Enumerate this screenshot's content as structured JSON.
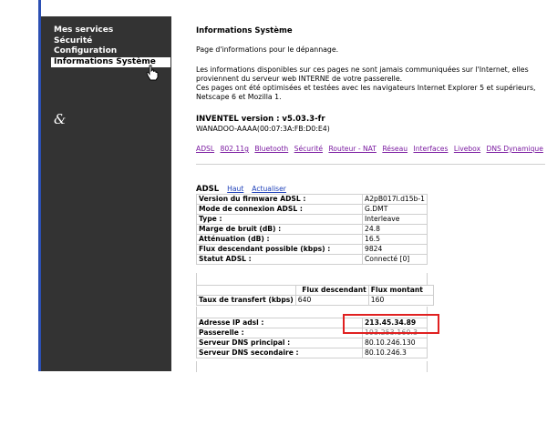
{
  "sidebar": {
    "items": [
      {
        "label": "Mes services"
      },
      {
        "label": "Sécurité"
      },
      {
        "label": "Configuration"
      },
      {
        "label": "Informations Système"
      }
    ],
    "logo": "&"
  },
  "main": {
    "title": "Informations Système",
    "intro": "Page d'informations pour le dépannage.",
    "desc1": "Les informations disponibles sur ces pages ne sont jamais communiquées sur l'Internet, elles",
    "desc2": "proviennent du serveur web INTERNE de votre passerelle.",
    "desc3": "Ces pages ont été optimisées et testées avec les navigateurs Internet Explorer 5 et supérieurs,",
    "desc4": "Netscape 6 et Mozilla 1.",
    "version": "INVENTEL version : v5.03.3-fr",
    "device": "WANADOO-AAAA(00:07:3A:FB:D0:E4)",
    "links": [
      "ADSL",
      "802.11g",
      "Bluetooth",
      "Sécurité",
      "Routeur - NAT",
      "Réseau",
      "Interfaces",
      "Livebox",
      "DNS Dynamique"
    ]
  },
  "adsl": {
    "heading": "ADSL",
    "haut": "Haut",
    "actualiser": "Actualiser",
    "rows": [
      {
        "label": "Version du firmware ADSL :",
        "value": "A2pB017l.d15b-1"
      },
      {
        "label": "Mode de connexion ADSL :",
        "value": "G.DMT"
      },
      {
        "label": "Type :",
        "value": "Interleave"
      },
      {
        "label": "Marge de bruit (dB) :",
        "value": "24.8"
      },
      {
        "label": "Atténuation (dB) :",
        "value": "16.5"
      },
      {
        "label": "Flux descendant possible (kbps) :",
        "value": "9824"
      },
      {
        "label": "Statut ADSL :",
        "value": "Connecté [0]"
      }
    ],
    "flux": {
      "col1": "Flux descendant",
      "col2": "Flux montant",
      "row_label": "Taux de transfert (kbps)",
      "down": "640",
      "up": "160"
    },
    "ip_rows": [
      {
        "label": "Adresse IP adsl :",
        "value": "213.45.34.89"
      },
      {
        "label": "Passerelle :",
        "value": "193.253.160.3"
      },
      {
        "label": "Serveur DNS principal :",
        "value": "80.10.246.130"
      },
      {
        "label": "Serveur DNS secondaire :",
        "value": "80.10.246.3"
      }
    ]
  },
  "colors": {
    "sidebar": "#333333",
    "link": "#7a1aa0",
    "highlight": "#e02020"
  }
}
